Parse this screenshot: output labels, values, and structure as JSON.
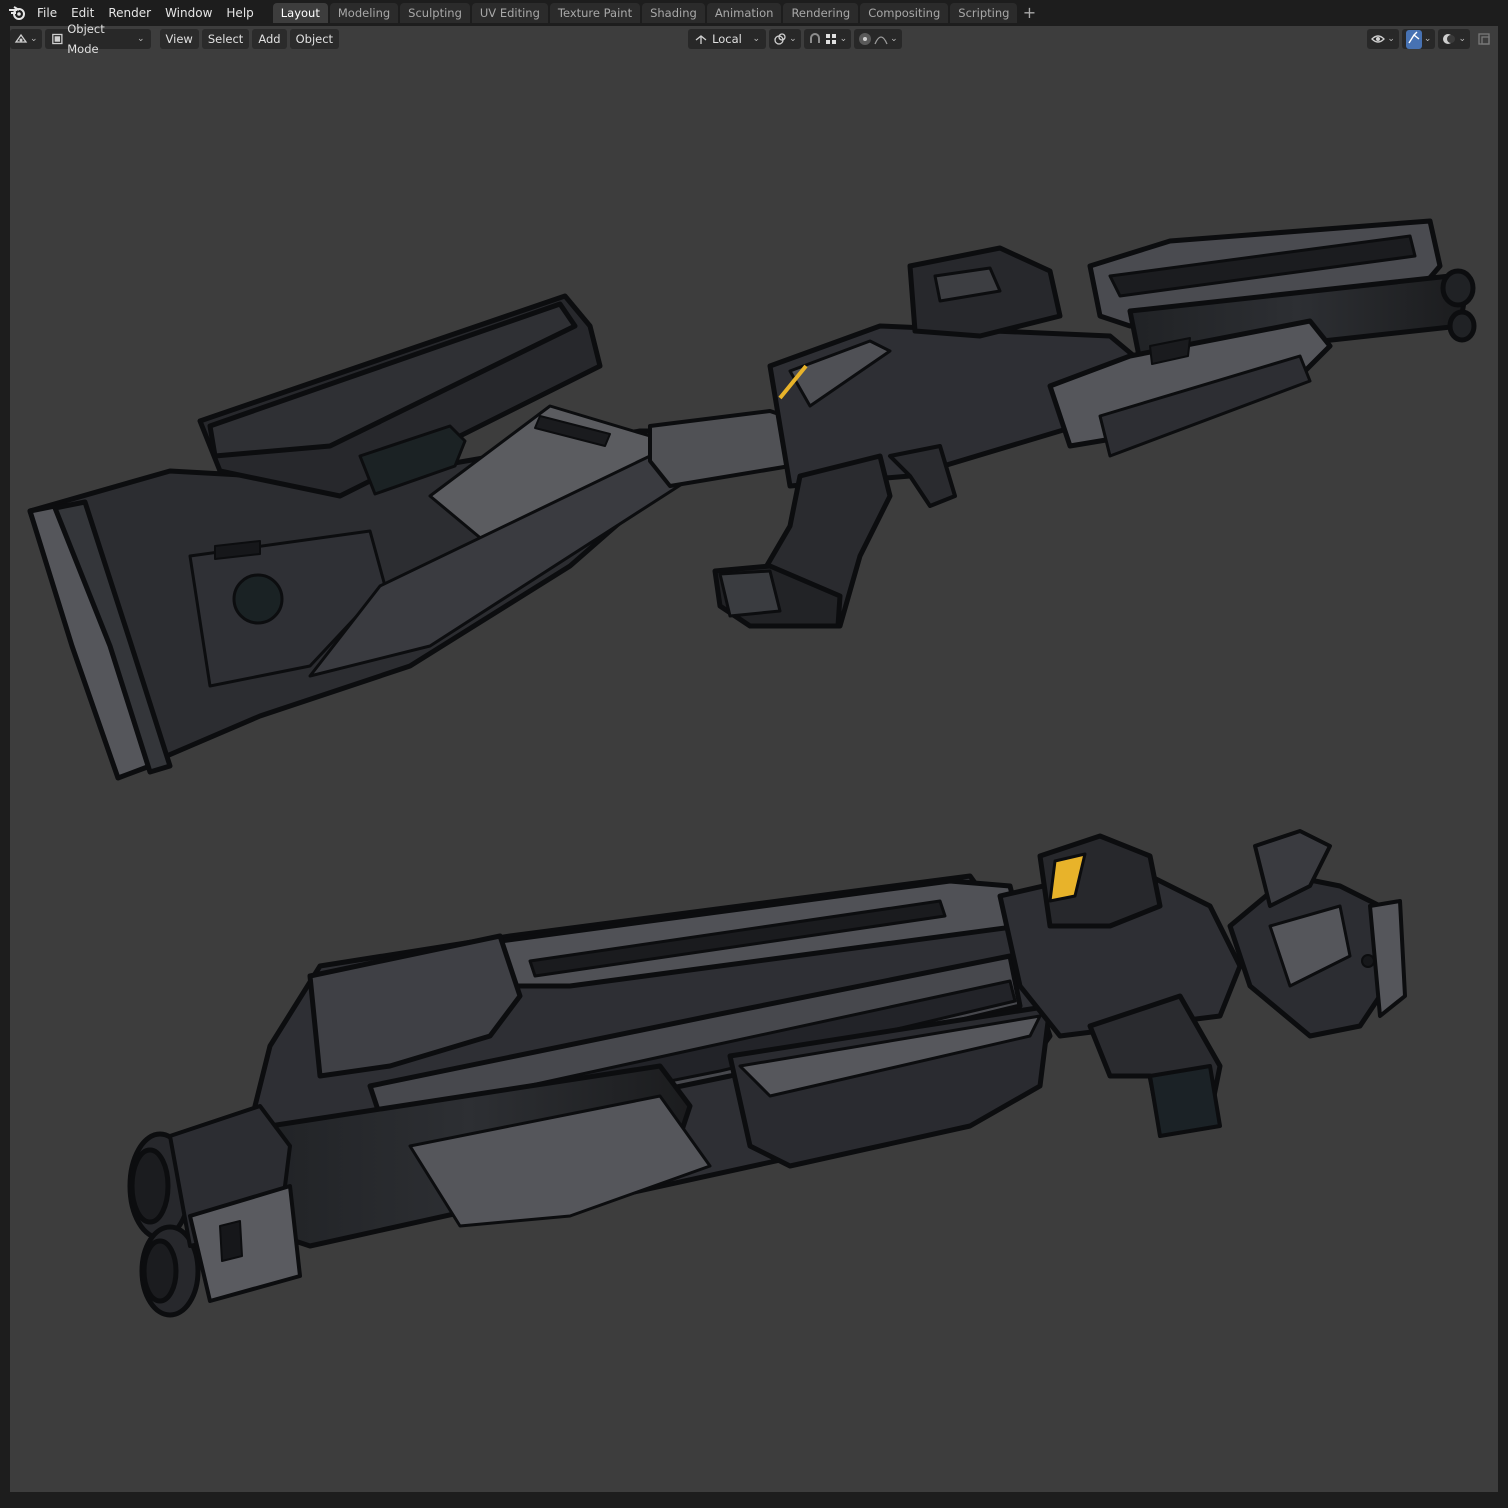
{
  "topbar": {
    "menus": [
      "File",
      "Edit",
      "Render",
      "Window",
      "Help"
    ],
    "tabs": [
      {
        "label": "Layout",
        "active": true
      },
      {
        "label": "Modeling",
        "active": false
      },
      {
        "label": "Sculpting",
        "active": false
      },
      {
        "label": "UV Editing",
        "active": false
      },
      {
        "label": "Texture Paint",
        "active": false
      },
      {
        "label": "Shading",
        "active": false
      },
      {
        "label": "Animation",
        "active": false
      },
      {
        "label": "Rendering",
        "active": false
      },
      {
        "label": "Compositing",
        "active": false
      },
      {
        "label": "Scripting",
        "active": false
      }
    ],
    "add_tab_symbol": "+"
  },
  "viewport_header": {
    "mode": "Object Mode",
    "menus": [
      "View",
      "Select",
      "Add",
      "Object"
    ],
    "transform_orientation": "Local"
  },
  "colors": {
    "accent_blue": "#4772b3",
    "viewport_bg": "#3d3d3d",
    "ui_bg": "#1d1d1d",
    "highlight_yellow": "#e8b32a"
  },
  "icons": [
    "blender-logo-icon",
    "editor-type-icon",
    "object-mode-icon",
    "transform-pivot-icon",
    "snap-icon",
    "snap-increment-icon",
    "proportional-edit-icon",
    "falloff-icon",
    "visibility-icon",
    "gizmo-icon",
    "overlay-icon",
    "xray-icon"
  ]
}
